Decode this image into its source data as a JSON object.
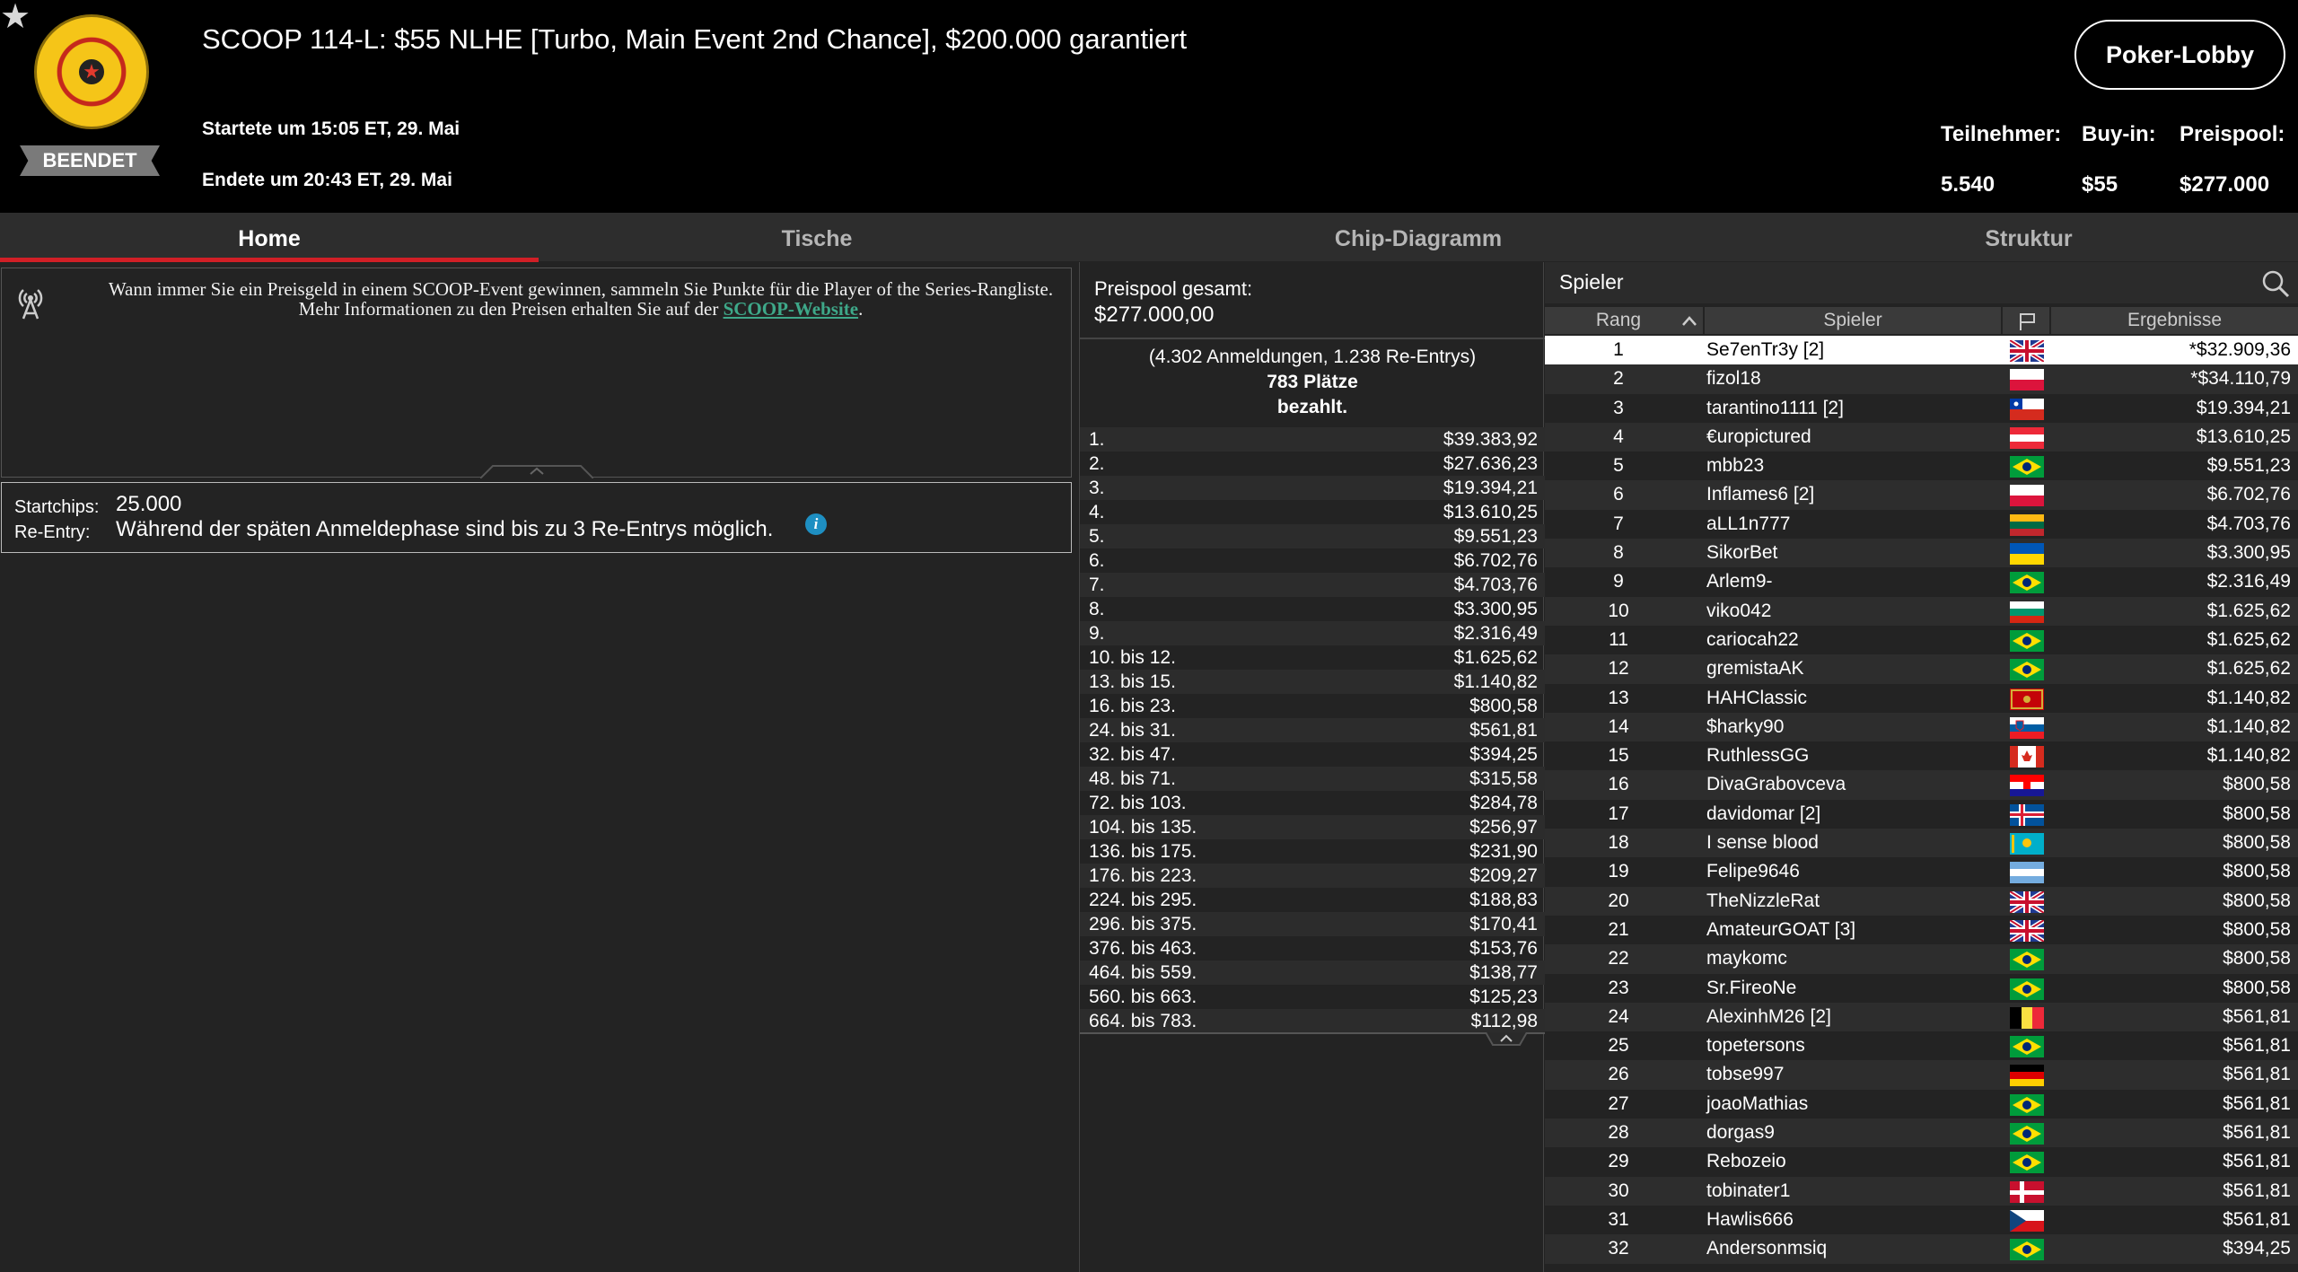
{
  "header": {
    "title": "SCOOP 114-L: $55 NLHE [Turbo, Main Event 2nd Chance], $200.000 garantiert",
    "status": "BEENDET",
    "start": "Startete um 15:05 ET, 29. Mai",
    "end": "Endete um 20:43 ET, 29. Mai",
    "lobby_button": "Poker-Lobby",
    "stats": [
      {
        "label": "Teilnehmer:",
        "value": "5.540"
      },
      {
        "label": "Buy-in:",
        "value": "$55"
      },
      {
        "label": "Preispool:",
        "value": "$277.000"
      }
    ]
  },
  "tabs": [
    "Home",
    "Tische",
    "Chip-Diagramm",
    "Struktur"
  ],
  "info": {
    "text_before": "Wann immer Sie ein Preisgeld in einem SCOOP-Event gewinnen, sammeln Sie Punkte für die Player of the Series-Rangliste. Mehr Informationen zu den Preisen erhalten Sie auf der ",
    "link": "SCOOP-Website",
    "text_after": "."
  },
  "chips": {
    "start_label": "Startchips:",
    "start_value": "25.000",
    "reentry_label": "Re-Entry:",
    "reentry_value": "Während der späten Anmeldephase sind bis zu 3 Re-Entrys möglich."
  },
  "prize": {
    "pool_label": "Preispool gesamt:",
    "pool_value": "$277.000,00",
    "entries": "(4.302 Anmeldungen, 1.238 Re-Entrys)",
    "places": "783 Plätze",
    "paid": "bezahlt.",
    "payouts": [
      [
        "1.",
        "$39.383,92"
      ],
      [
        "2.",
        "$27.636,23"
      ],
      [
        "3.",
        "$19.394,21"
      ],
      [
        "4.",
        "$13.610,25"
      ],
      [
        "5.",
        "$9.551,23"
      ],
      [
        "6.",
        "$6.702,76"
      ],
      [
        "7.",
        "$4.703,76"
      ],
      [
        "8.",
        "$3.300,95"
      ],
      [
        "9.",
        "$2.316,49"
      ],
      [
        "10. bis 12.",
        "$1.625,62"
      ],
      [
        "13. bis 15.",
        "$1.140,82"
      ],
      [
        "16. bis 23.",
        "$800,58"
      ],
      [
        "24. bis 31.",
        "$561,81"
      ],
      [
        "32. bis 47.",
        "$394,25"
      ],
      [
        "48. bis 71.",
        "$315,58"
      ],
      [
        "72. bis 103.",
        "$284,78"
      ],
      [
        "104. bis 135.",
        "$256,97"
      ],
      [
        "136. bis 175.",
        "$231,90"
      ],
      [
        "176. bis 223.",
        "$209,27"
      ],
      [
        "224. bis 295.",
        "$188,83"
      ],
      [
        "296. bis 375.",
        "$170,41"
      ],
      [
        "376. bis 463.",
        "$153,76"
      ],
      [
        "464. bis 559.",
        "$138,77"
      ],
      [
        "560. bis 663.",
        "$125,23"
      ],
      [
        "664. bis 783.",
        "$112,98"
      ]
    ]
  },
  "players": {
    "title": "Spieler",
    "columns": {
      "rank": "Rang",
      "player": "Spieler",
      "results": "Ergebnisse"
    },
    "rows": [
      {
        "rank": "1",
        "name": "Se7enTr3y [2]",
        "flag": "gb",
        "result": "*$32.909,36"
      },
      {
        "rank": "2",
        "name": "fizol18",
        "flag": "pl",
        "result": "*$34.110,79"
      },
      {
        "rank": "3",
        "name": "tarantino1111 [2]",
        "flag": "cl",
        "result": "$19.394,21"
      },
      {
        "rank": "4",
        "name": "€uropictured",
        "flag": "at",
        "result": "$13.610,25"
      },
      {
        "rank": "5",
        "name": "mbb23",
        "flag": "br",
        "result": "$9.551,23"
      },
      {
        "rank": "6",
        "name": "Inflames6 [2]",
        "flag": "pl",
        "result": "$6.702,76"
      },
      {
        "rank": "7",
        "name": "aLL1n777",
        "flag": "lt",
        "result": "$4.703,76"
      },
      {
        "rank": "8",
        "name": "SikorBet",
        "flag": "ua",
        "result": "$3.300,95"
      },
      {
        "rank": "9",
        "name": "Arlem9-",
        "flag": "br",
        "result": "$2.316,49"
      },
      {
        "rank": "10",
        "name": "viko042",
        "flag": "bg",
        "result": "$1.625,62"
      },
      {
        "rank": "11",
        "name": "cariocah22",
        "flag": "br",
        "result": "$1.625,62"
      },
      {
        "rank": "12",
        "name": "gremistaAK",
        "flag": "br",
        "result": "$1.625,62"
      },
      {
        "rank": "13",
        "name": "HAHClassic",
        "flag": "me",
        "result": "$1.140,82"
      },
      {
        "rank": "14",
        "name": "$harky90",
        "flag": "si",
        "result": "$1.140,82"
      },
      {
        "rank": "15",
        "name": "RuthlessGG",
        "flag": "ca",
        "result": "$1.140,82"
      },
      {
        "rank": "16",
        "name": "DivaGrabovceva",
        "flag": "hr",
        "result": "$800,58"
      },
      {
        "rank": "17",
        "name": "davidomar [2]",
        "flag": "is",
        "result": "$800,58"
      },
      {
        "rank": "18",
        "name": "I sense blood",
        "flag": "kz",
        "result": "$800,58"
      },
      {
        "rank": "19",
        "name": "Felipe9646",
        "flag": "ar",
        "result": "$800,58"
      },
      {
        "rank": "20",
        "name": "TheNizzleRat",
        "flag": "gb",
        "result": "$800,58"
      },
      {
        "rank": "21",
        "name": "AmateurGOAT [3]",
        "flag": "gb",
        "result": "$800,58"
      },
      {
        "rank": "22",
        "name": "maykomc",
        "flag": "br",
        "result": "$800,58"
      },
      {
        "rank": "23",
        "name": "Sr.FireoNe",
        "flag": "br",
        "result": "$800,58"
      },
      {
        "rank": "24",
        "name": "AlexinhM26 [2]",
        "flag": "be",
        "result": "$561,81"
      },
      {
        "rank": "25",
        "name": "topetersons",
        "flag": "br",
        "result": "$561,81"
      },
      {
        "rank": "26",
        "name": "tobse997",
        "flag": "de",
        "result": "$561,81"
      },
      {
        "rank": "27",
        "name": "joaoMathias",
        "flag": "br",
        "result": "$561,81"
      },
      {
        "rank": "28",
        "name": "dorgas9",
        "flag": "br",
        "result": "$561,81"
      },
      {
        "rank": "29",
        "name": "Rebozeio",
        "flag": "br",
        "result": "$561,81"
      },
      {
        "rank": "30",
        "name": "tobinater1",
        "flag": "dk",
        "result": "$561,81"
      },
      {
        "rank": "31",
        "name": "Hawlis666",
        "flag": "cz",
        "result": "$561,81"
      },
      {
        "rank": "32",
        "name": "Andersonmsiq",
        "flag": "br",
        "result": "$394,25"
      }
    ]
  }
}
